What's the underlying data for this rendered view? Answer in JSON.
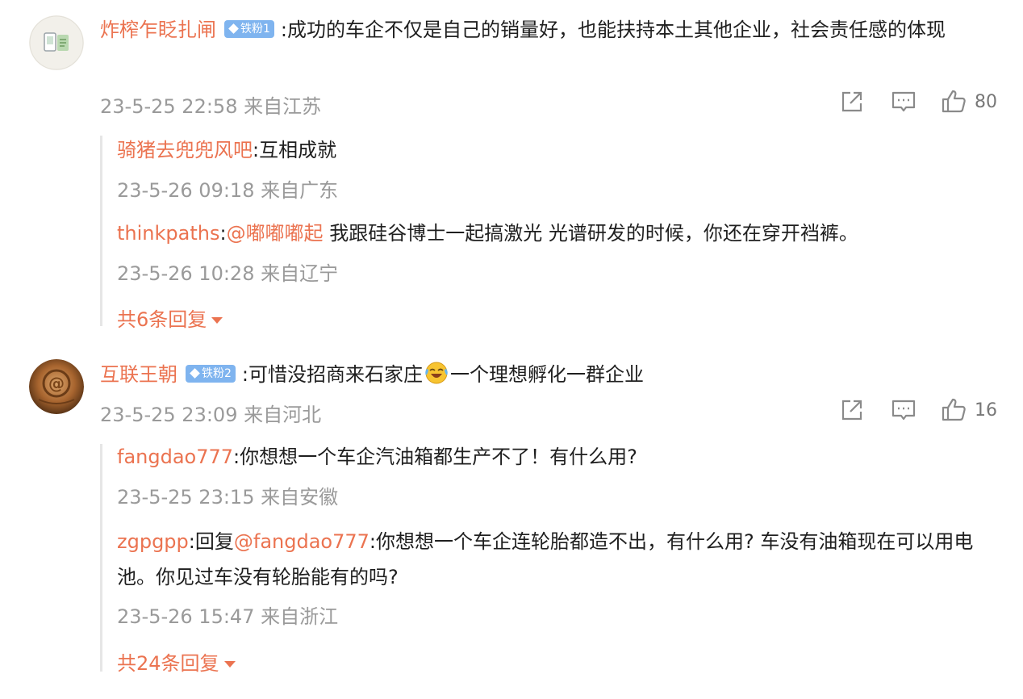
{
  "colors": {
    "username": "#eb7350",
    "meta": "#9a9a9a",
    "badge": "#7fb4ef",
    "border": "#e6e6e6"
  },
  "comments": [
    {
      "username": "炸榨乍眨扎闸",
      "badge": "铁粉1",
      "text": ":成功的车企不仅是自己的销量好，也能扶持本土其他企业，社会责任感的体现",
      "meta": "23-5-25 22:58 来自江苏",
      "likes": "80",
      "replies": [
        {
          "user": "骑猪去兜兜风吧",
          "text": ":互相成就",
          "meta": "23-5-26 09:18 来自广东"
        },
        {
          "user": "thinkpaths",
          "colon": ":",
          "mention": "@嘟嘟嘟起",
          "text": " 我跟硅谷博士一起搞激光 光谱研发的时候，你还在穿开裆裤。",
          "meta": "23-5-26 10:28 来自辽宁"
        }
      ],
      "more": "共6条回复"
    },
    {
      "username": "互联王朝",
      "badge": "铁粉2",
      "text_before": ":可惜没招商来石家庄",
      "emoji": "laugh-cry-emoji",
      "text_after": "一个理想孵化一群企业",
      "meta": "23-5-25 23:09 来自河北",
      "likes": "16",
      "replies": [
        {
          "user": "fangdao777",
          "text": ":你想想一个车企汽油箱都生产不了！有什么用?",
          "meta": "23-5-25 23:15 来自安徽"
        },
        {
          "user": "zgpgpp",
          "prefix": ":回复",
          "mention": "@fangdao777",
          "text": ":你想想一个车企连轮胎都造不出，有什么用? 车没有油箱现在可以用电池。你见过车没有轮胎能有的吗?",
          "meta": "23-5-26 15:47 来自浙江"
        }
      ],
      "more": "共24条回复"
    }
  ]
}
